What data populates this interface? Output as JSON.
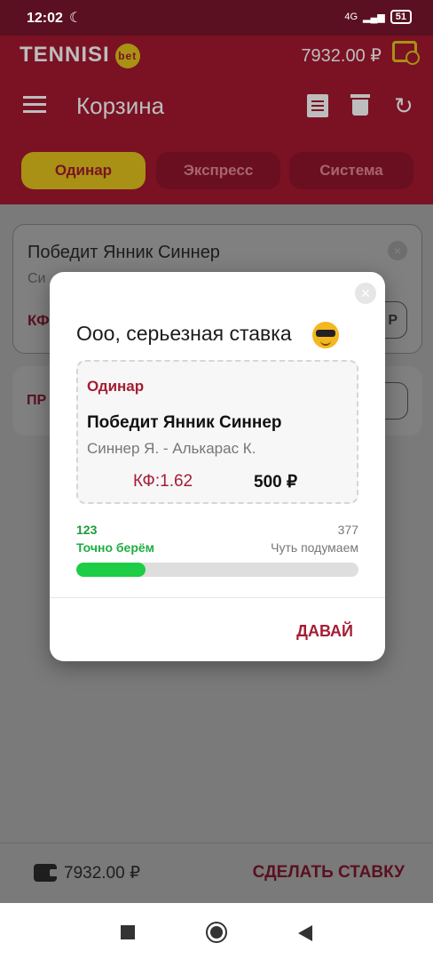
{
  "status_bar": {
    "time": "12:02",
    "network": "4G",
    "battery": "51"
  },
  "app": {
    "brand": "TENNISI",
    "brand_badge": "bet",
    "balance": "7932.00 ₽"
  },
  "toolbar": {
    "title": "Корзина"
  },
  "tabs": [
    {
      "label": "Одинар",
      "active": true
    },
    {
      "label": "Экспресс"
    },
    {
      "label": "Система"
    }
  ],
  "background_card": {
    "title": "Победит Янник Синнер",
    "subtitle_partial": "Си",
    "kf_partial": "КФ",
    "input_partial": "Р"
  },
  "background_card2": {
    "label_partial": "ПР"
  },
  "bottom_bar": {
    "balance": "7932.00 ₽",
    "make_bet": "СДЕЛАТЬ СТАВКУ"
  },
  "modal": {
    "title": "Ооо, серьезная ставка",
    "emoji": "smiling-face-with-sunglasses",
    "ticket": {
      "type": "Одинар",
      "selection": "Победит Янник Синнер",
      "match": "Синнер Я. - Алькарас К.",
      "kf": "КФ:1.62",
      "amount": "500 ₽"
    },
    "stats": {
      "left_count": "123",
      "left_label": "Точно берём",
      "right_count": "377",
      "right_label": "Чуть подумаем",
      "agree_fraction": 0.246
    },
    "action": "ДАВАЙ"
  },
  "colors": {
    "brand": "#a51d34",
    "accent": "#1ccd45",
    "gold": "#a89114"
  }
}
